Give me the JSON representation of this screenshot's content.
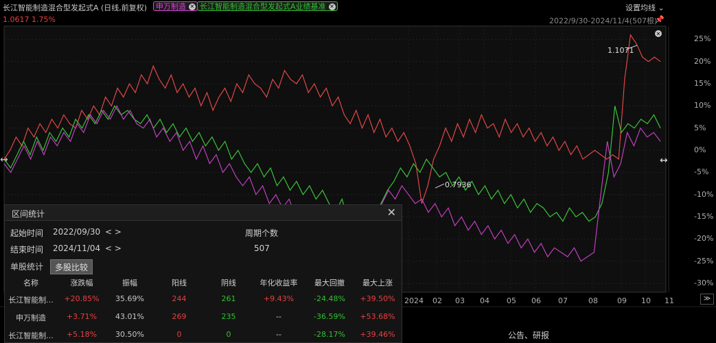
{
  "header": {
    "title": "长江智能制造混合型发起式A (日线,前复权)",
    "tags": [
      {
        "label": "申万制造",
        "color": "#e040e0"
      },
      {
        "label": "长江智能制造混合型发起式A业绩基准",
        "color": "#2fc32f"
      }
    ],
    "setting_label": "设置均线 ⌄",
    "price": "1.0617 1.75%",
    "date_range": "2022/9/30-2024/11/4(507根)"
  },
  "chart_data": {
    "type": "line",
    "y_ticks": [
      "25%",
      "20%",
      "15%",
      "10%",
      "5%",
      "0%",
      "-5%",
      "-10%",
      "-15%",
      "-20%",
      "-25%",
      "-30%"
    ],
    "y_range": [
      -32,
      28
    ],
    "x_ticks": [
      "2024",
      "02",
      "03",
      "04",
      "05",
      "06",
      "07",
      "08",
      "09",
      "10",
      "11"
    ],
    "annotations": {
      "max": "1.1071",
      "min": "0.7936"
    },
    "series": [
      {
        "name": "长江智能制造混合型发起式A",
        "color": "#e04848",
        "values": [
          -2,
          0,
          3,
          1,
          5,
          3,
          6,
          4,
          7,
          5,
          8,
          6,
          5,
          9,
          7,
          10,
          8,
          12,
          10,
          14,
          12,
          15,
          13,
          17,
          15,
          19,
          16,
          14,
          17,
          13,
          15,
          12,
          14,
          10,
          13,
          9,
          12,
          14,
          11,
          15,
          13,
          17,
          15,
          14,
          12,
          16,
          14,
          18,
          16,
          15,
          17,
          13,
          15,
          12,
          14,
          10,
          12,
          8,
          6,
          9,
          5,
          8,
          4,
          7,
          3,
          5,
          2,
          4,
          1,
          -3,
          -12,
          -8,
          -2,
          1,
          5,
          2,
          6,
          3,
          7,
          4,
          8,
          5,
          6,
          3,
          7,
          4,
          6,
          3,
          5,
          2,
          4,
          1,
          3,
          0,
          2,
          -1,
          1,
          -2,
          -1,
          0,
          -1,
          -2,
          -1,
          -2,
          16,
          26,
          24,
          21,
          20,
          21,
          20
        ]
      },
      {
        "name": "申万制造",
        "color": "#3bc43b",
        "values": [
          -2,
          -4,
          -1,
          2,
          -1,
          3,
          0,
          4,
          2,
          5,
          3,
          7,
          5,
          8,
          6,
          9,
          7,
          10,
          8,
          9,
          7,
          6,
          8,
          5,
          7,
          4,
          6,
          3,
          5,
          2,
          4,
          1,
          3,
          0,
          2,
          -2,
          0,
          -3,
          -5,
          -3,
          -6,
          -4,
          -8,
          -6,
          -9,
          -7,
          -10,
          -8,
          -11,
          -9,
          -12,
          -14,
          -11,
          -16,
          -19,
          -22,
          -18,
          -15,
          -12,
          -9,
          -7,
          -4,
          -6,
          -3,
          -5,
          -2,
          -4,
          -6,
          -5,
          -8,
          -6,
          -9,
          -7,
          -10,
          -8,
          -11,
          -9,
          -12,
          -10,
          -13,
          -11,
          -14,
          -12,
          -13,
          -15,
          -14,
          -16,
          -13,
          -15,
          -14,
          -16,
          -15,
          -12,
          -5,
          10,
          4,
          6,
          5,
          7,
          6,
          8,
          5
        ]
      },
      {
        "name": "长江智能制造混合型发起式A业绩基准",
        "color": "#c040c0",
        "values": [
          -3,
          -5,
          -2,
          1,
          -2,
          2,
          -1,
          3,
          1,
          4,
          2,
          6,
          4,
          8,
          6,
          9,
          7,
          10,
          7,
          9,
          6,
          5,
          7,
          3,
          5,
          2,
          4,
          0,
          2,
          -2,
          1,
          -3,
          -1,
          -5,
          -3,
          -6,
          -8,
          -6,
          -10,
          -8,
          -12,
          -10,
          -13,
          -11,
          -15,
          -13,
          -17,
          -15,
          -16,
          -14,
          -18,
          -22,
          -26,
          -30,
          -24,
          -20,
          -16,
          -12,
          -9,
          -11,
          -8,
          -10,
          -12,
          -11,
          -14,
          -12,
          -15,
          -13,
          -17,
          -15,
          -18,
          -16,
          -19,
          -17,
          -20,
          -18,
          -21,
          -19,
          -22,
          -20,
          -23,
          -21,
          -24,
          -22,
          -23,
          -24,
          -22,
          -25,
          -24,
          -23,
          -10,
          2,
          -6,
          -3,
          4,
          1,
          5,
          3,
          4,
          2
        ]
      }
    ]
  },
  "stats_panel": {
    "title": "区间统计",
    "start_label": "起始时间",
    "start_value": "2022/09/30",
    "end_label": "结束时间",
    "end_value": "2024/11/04",
    "nav_arrows": "< >",
    "period_label": "周期个数",
    "period_value": "507",
    "tabs": [
      "单股统计",
      "多股比较"
    ],
    "columns": [
      "名称",
      "涨跌幅",
      "振幅",
      "阳线",
      "阴线",
      "年化收益率",
      "最大回撤",
      "最大上涨"
    ],
    "rows": [
      [
        "长江智能制...",
        "+20.85%",
        "35.69%",
        "244",
        "261",
        "+9.43%",
        "-24.48%",
        "+39.50%"
      ],
      [
        "申万制造",
        "+3.71%",
        "43.01%",
        "269",
        "235",
        "--",
        "-36.59%",
        "+53.68%"
      ],
      [
        "长江智能制...",
        "+5.18%",
        "30.50%",
        "0",
        "0",
        "--",
        "-28.17%",
        "+39.46%"
      ]
    ]
  },
  "footer": {
    "notice": "公告、研报"
  }
}
